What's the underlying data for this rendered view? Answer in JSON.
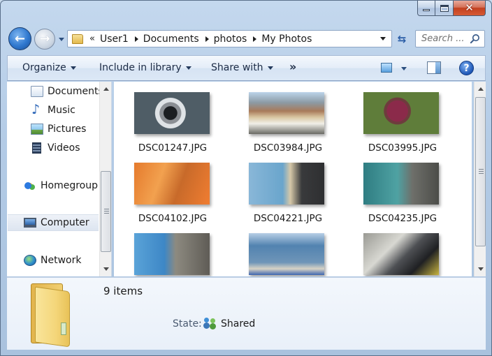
{
  "window": {
    "title": ""
  },
  "navigation": {
    "breadcrumb": [
      "User1",
      "Documents",
      "photos",
      "My Photos"
    ],
    "overflow_glyph": "«",
    "search_placeholder": "Search ..."
  },
  "toolbar": {
    "organize": "Organize",
    "include_in_library": "Include in library",
    "share_with": "Share with",
    "more": "»",
    "help": "?"
  },
  "nav_pane": {
    "items": [
      {
        "label": "Documents",
        "icon": "documents-icon"
      },
      {
        "label": "Music",
        "icon": "music-icon"
      },
      {
        "label": "Pictures",
        "icon": "pictures-icon"
      },
      {
        "label": "Videos",
        "icon": "videos-icon"
      },
      {
        "label": "Homegroup",
        "icon": "homegroup-icon"
      },
      {
        "label": "Computer",
        "icon": "computer-icon"
      },
      {
        "label": "Network",
        "icon": "network-icon"
      }
    ],
    "selected": "Computer"
  },
  "files": [
    {
      "name": "DSC01247.JPG"
    },
    {
      "name": "DSC03984.JPG"
    },
    {
      "name": "DSC03995.JPG"
    },
    {
      "name": "DSC04102.JPG"
    },
    {
      "name": "DSC04221.JPG"
    },
    {
      "name": "DSC04235.JPG"
    },
    {
      "name": ""
    },
    {
      "name": ""
    },
    {
      "name": ""
    }
  ],
  "details": {
    "items_count": "9 items",
    "state_label": "State:",
    "state_value": "Shared"
  }
}
